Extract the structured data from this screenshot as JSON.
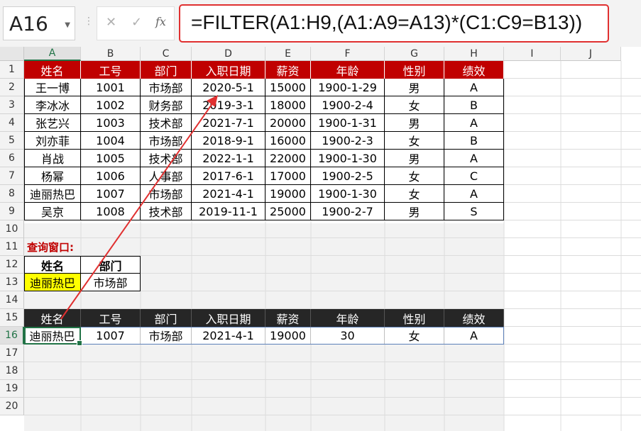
{
  "formula_bar": {
    "name_box": "A16",
    "cancel_icon": "✕",
    "enter_icon": "✓",
    "fx_icon": "fx",
    "formula": "=FILTER(A1:H9,(A1:A9=A13)*(C1:C9=B13))"
  },
  "columns": [
    "A",
    "B",
    "C",
    "D",
    "E",
    "F",
    "G",
    "H",
    "I",
    "J"
  ],
  "rows": [
    "1",
    "2",
    "3",
    "4",
    "5",
    "6",
    "7",
    "8",
    "9",
    "10",
    "11",
    "12",
    "13",
    "14",
    "15",
    "16",
    "17",
    "18",
    "19",
    "20"
  ],
  "active_cell": "A16",
  "table": {
    "header": [
      "姓名",
      "工号",
      "部门",
      "入职日期",
      "薪资",
      "年龄",
      "性别",
      "绩效"
    ],
    "rows": [
      [
        "王一博",
        "1001",
        "市场部",
        "2020-5-1",
        "15000",
        "1900-1-29",
        "男",
        "A"
      ],
      [
        "李冰冰",
        "1002",
        "财务部",
        "2019-3-1",
        "18000",
        "1900-2-4",
        "女",
        "B"
      ],
      [
        "张艺兴",
        "1003",
        "技术部",
        "2021-7-1",
        "20000",
        "1900-1-31",
        "男",
        "A"
      ],
      [
        "刘亦菲",
        "1004",
        "市场部",
        "2018-9-1",
        "16000",
        "1900-2-3",
        "女",
        "B"
      ],
      [
        "肖战",
        "1005",
        "技术部",
        "2022-1-1",
        "22000",
        "1900-1-30",
        "男",
        "A"
      ],
      [
        "杨幂",
        "1006",
        "人事部",
        "2017-6-1",
        "17000",
        "1900-2-5",
        "女",
        "C"
      ],
      [
        "迪丽热巴",
        "1007",
        "市场部",
        "2021-4-1",
        "19000",
        "1900-1-30",
        "女",
        "A"
      ],
      [
        "吴京",
        "1008",
        "技术部",
        "2019-11-1",
        "25000",
        "1900-2-7",
        "男",
        "S"
      ]
    ]
  },
  "query": {
    "title": "查询窗口:",
    "labels": [
      "姓名",
      "部门"
    ],
    "values": [
      "迪丽热巴",
      "市场部"
    ]
  },
  "result": {
    "header": [
      "姓名",
      "工号",
      "部门",
      "入职日期",
      "薪资",
      "年龄",
      "性别",
      "绩效"
    ],
    "row": [
      "迪丽热巴",
      "1007",
      "市场部",
      "2021-4-1",
      "19000",
      "30",
      "女",
      "A"
    ]
  },
  "colors": {
    "header_red": "#c00000",
    "header_dark": "#262626",
    "highlight_yellow": "#ffff00",
    "annotation_red": "#e03030",
    "excel_green": "#217346"
  }
}
